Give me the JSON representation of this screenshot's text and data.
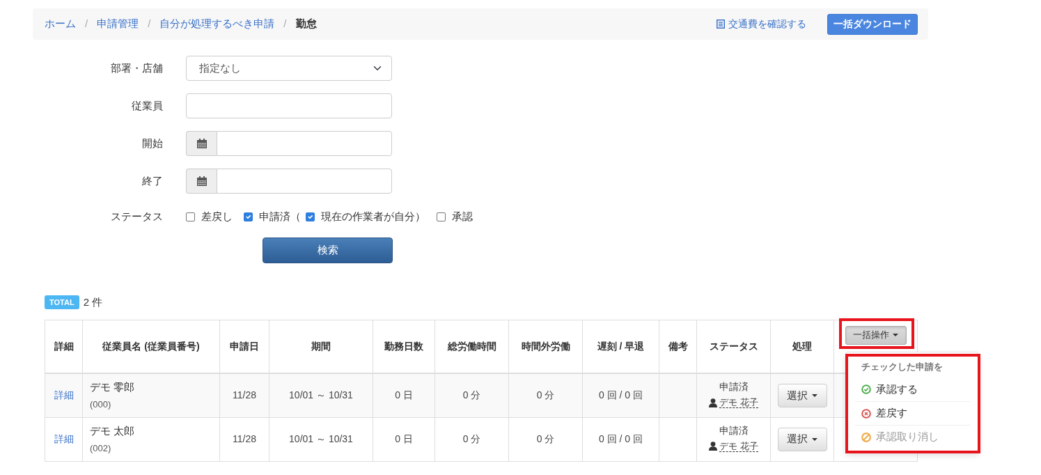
{
  "breadcrumb": {
    "separator": "/",
    "items": [
      {
        "label": "ホーム",
        "current": false
      },
      {
        "label": "申請管理",
        "current": false
      },
      {
        "label": "自分が処理するべき申請",
        "current": false
      },
      {
        "label": "勤怠",
        "current": true
      }
    ]
  },
  "toolbar": {
    "link": "交通費を確認する",
    "button": "一括ダウンロード"
  },
  "filters": [
    {
      "kind": "select",
      "label": "部署・店舗",
      "value": "指定なし"
    },
    {
      "kind": "text",
      "label": "従業員"
    },
    {
      "kind": "date",
      "label": "開始"
    },
    {
      "kind": "date",
      "label": "終了"
    }
  ],
  "status_filter": {
    "label": "ステータス",
    "options": [
      {
        "label": "差戻し",
        "checked": false
      },
      {
        "label": "申請済（",
        "checked": true
      },
      {
        "label": "現在の作業者が自分）",
        "checked": true
      },
      {
        "label": "承認",
        "checked": false
      }
    ]
  },
  "search_button": "検索",
  "total": {
    "badge": "TOTAL",
    "count": "2 件"
  },
  "table": {
    "columns": [
      "詳細",
      "従業員名 (従業員番号)",
      "申請日",
      "期間",
      "勤務日数",
      "総労働時間",
      "時間外労働",
      "遅刻 / 早退",
      "備考",
      "ステータス",
      "処理"
    ],
    "bulk_button": "一括操作",
    "rows": [
      {
        "detail": "詳細",
        "name": "デモ 零郎",
        "number": "(000)",
        "applied": "11/28",
        "period": "10/01 ～ 10/31",
        "work_days": "0 日",
        "total_time": "0 分",
        "overtime": "0 分",
        "late_early": "0 回 / 0 回",
        "status": "申請済",
        "assignee": "デモ 花子",
        "action": "選択"
      },
      {
        "detail": "詳細",
        "name": "デモ 太郎",
        "number": "(002)",
        "applied": "11/28",
        "period": "10/01 ～ 10/31",
        "work_days": "0 日",
        "total_time": "0 分",
        "overtime": "0 分",
        "late_early": "0 回 / 0 回",
        "status": "申請済",
        "assignee": "デモ 花子",
        "action": "選択"
      }
    ]
  },
  "bulk_menu": {
    "open": true,
    "header": "チェックした申請を",
    "items": [
      {
        "kind": "approve",
        "label": "承認する",
        "disabled": false
      },
      {
        "kind": "reject",
        "label": "差戻す",
        "disabled": false
      },
      {
        "kind": "cancel",
        "label": "承認取り消し",
        "disabled": true
      }
    ]
  }
}
